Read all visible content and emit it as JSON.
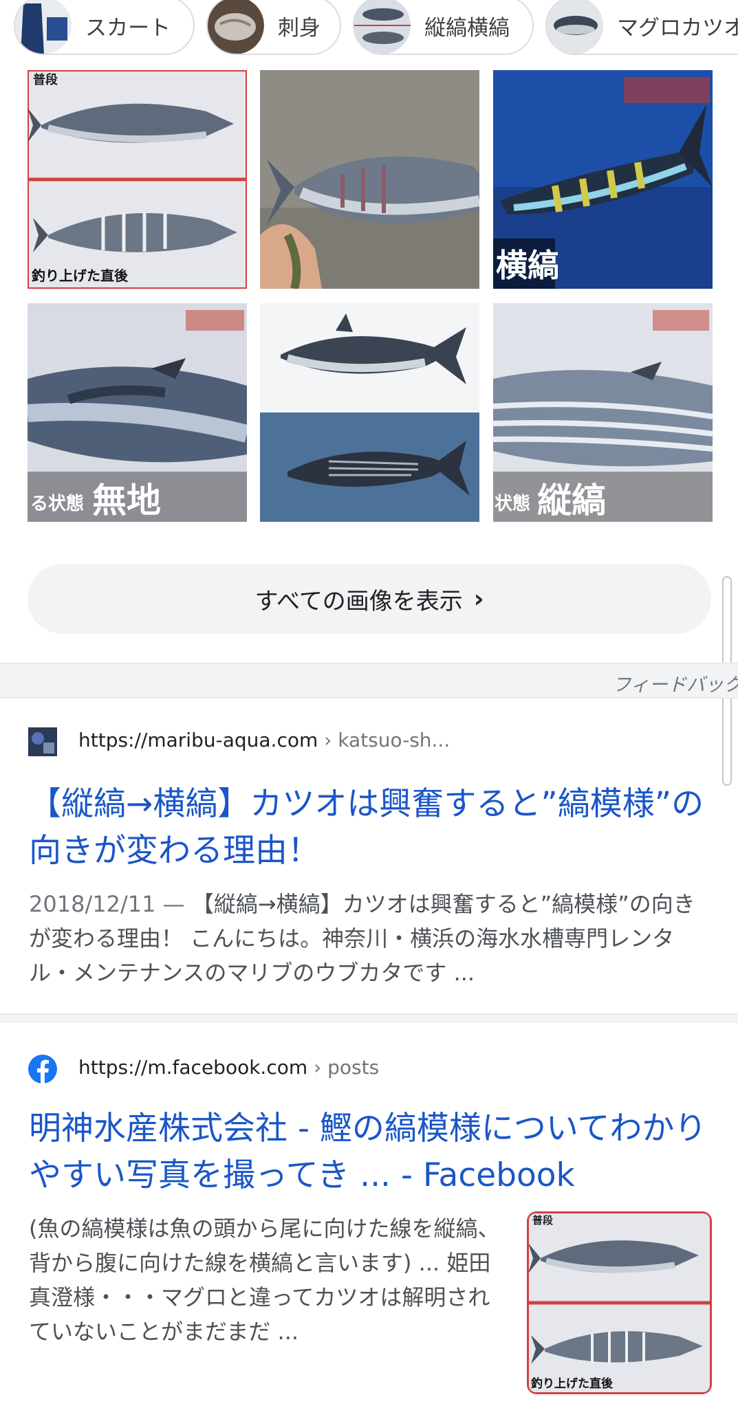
{
  "chips": [
    {
      "label": "スカート",
      "icon": "skirt-thumbnail"
    },
    {
      "label": "刺身",
      "icon": "sashimi-thumbnail"
    },
    {
      "label": "縦縞横縞",
      "icon": "stripes-thumbnail"
    },
    {
      "label": "マグロカツオ",
      "icon": "tuna-thumbnail"
    }
  ],
  "images": {
    "tile1": {
      "top_caption": "普段",
      "bottom_caption": "釣り上げた直後"
    },
    "tile2": {},
    "tile3": {
      "caption": "横縞"
    },
    "tile4": {
      "caption_small": "る状態",
      "caption": "無地"
    },
    "tile5": {},
    "tile6": {
      "caption_small": "状態",
      "caption": "縦縞"
    }
  },
  "show_all": {
    "label": "すべての画像を表示",
    "chevron": "›"
  },
  "feedback": "フィードバック",
  "results": [
    {
      "url": "https://maribu-aqua.com",
      "crumb": " › katsuo-sh...",
      "title": "【縦縞→横縞】カツオは興奮すると”縞模様”の向きが変わる理由！",
      "date": "2018/12/11 — ",
      "snippet": "【縦縞→横縞】カツオは興奮すると”縞模様”の向きが変わる理由！ こんにちは。神奈川・横浜の海水水槽専門レンタル・メンテナンスのマリブのウブカタです ..."
    },
    {
      "url": "https://m.facebook.com",
      "crumb": " › posts",
      "title": "明神水産株式会社 - 鰹の縞模様についてわかりやすい写真を撮ってき ... - Facebook",
      "snippet": "(魚の縞模様は魚の頭から尾に向けた線を縦縞、背から腹に向けた線を横縞と言います) ... 姫田真澄様・・・マグロと違ってカツオは解明されていないことがまだまだ ...",
      "thumb": {
        "top_caption": "普段",
        "bottom_caption": "釣り上げた直後"
      }
    }
  ],
  "colors": {
    "link": "#1a56c8",
    "chip_border": "#dadce0",
    "band": "#f1f3f4"
  }
}
